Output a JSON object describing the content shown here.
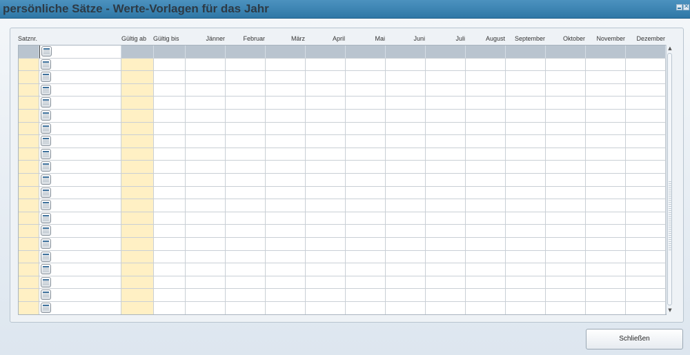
{
  "window": {
    "title": "persönliche Sätze - Werte-Vorlagen für das Jahr",
    "minimize_icon": "minimize-icon",
    "close_icon": "close-icon",
    "close_glyph": "✕"
  },
  "table": {
    "columns": [
      "Satznr.",
      "",
      "Gültig ab",
      "Gültig bis",
      "Jänner",
      "Februar",
      "März",
      "April",
      "Mai",
      "Juni",
      "Juli",
      "August",
      "September",
      "Oktober",
      "November",
      "Dezember"
    ],
    "row_count": 21,
    "row_icon": "calendar-icon"
  },
  "scrollbar": {
    "up_glyph": "▲",
    "down_glyph": "▼"
  },
  "footer": {
    "close_label": "Schließen"
  },
  "colors": {
    "titlebar": "#3a84b3",
    "highlight_column": "#fff0c4",
    "header_row": "#b9c4cf"
  }
}
